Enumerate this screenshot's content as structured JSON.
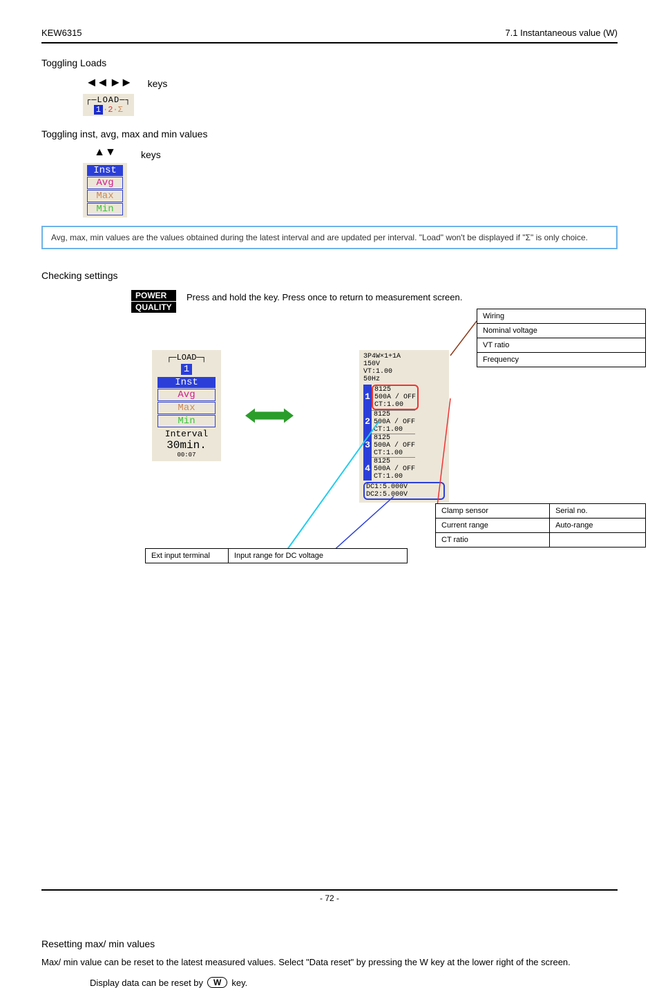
{
  "header": {
    "left": "KEW6315",
    "right": "7.1 Instantaneous value (W)"
  },
  "toggle_loads": {
    "title": "Toggling Loads",
    "keys_label": "keys",
    "load_header": "LOAD",
    "load_1": "1",
    "load_2": "2",
    "load_sigma": "Σ",
    "arrows_lr": "◄◄ ►►",
    "arrows_ud": "▲▼"
  },
  "toggle_values": {
    "title": "Toggling inst, avg, max and min values",
    "keys_label": "keys",
    "inst": "Inst",
    "avg": "Avg",
    "max": "Max",
    "min": "Min"
  },
  "note_box": "Avg, max, min values are the values obtained during the latest interval and are updated per interval. \"Load\" won't be displayed if \"Σ\" is only choice.",
  "settings": {
    "title": "Checking settings",
    "badge1": "POWER",
    "badge2": "QUALITY",
    "desc": "Press and hold the key. Press once to return to measurement screen.",
    "panel_load": "LOAD",
    "panel_1": "1",
    "inst": "Inst",
    "avg": "Avg",
    "max": "Max",
    "min": "Min",
    "interval_label": "Interval",
    "interval_val": "30min.",
    "interval_sub": "00:07",
    "right_top_line1": "3P4W×1+1A",
    "right_top_line2": "150V",
    "right_top_line3": "VT:1.00",
    "right_top_line4": "50Hz",
    "ch_l1": "8125",
    "ch_l2": "500A / OFF",
    "ch_l3": "CT:1.00",
    "dc1": "DC1:5.000V",
    "dc2": "DC2:5.000V",
    "common_table": {
      "r1": "Wiring",
      "r2": "Nominal voltage",
      "r3": "VT ratio",
      "r4": "Frequency"
    },
    "ch_table": {
      "r1c1": "Clamp sensor",
      "r1c2": "Serial no.",
      "r2c1": "Current range",
      "r2c2": "Auto-range",
      "r3c1": "CT ratio",
      "r3c2": ""
    },
    "ext_table": {
      "c1": "Ext input terminal",
      "c2": "Input range for DC voltage"
    }
  },
  "resetting": {
    "title": "Resetting max/ min values",
    "text": "Max/ min value can be reset to the latest measured values. Select \"Data reset\" by pressing the W key at the lower right of the screen.",
    "line": "Display data can be reset by",
    "badge": "W",
    "after": "key."
  },
  "footer": "- 72 -"
}
